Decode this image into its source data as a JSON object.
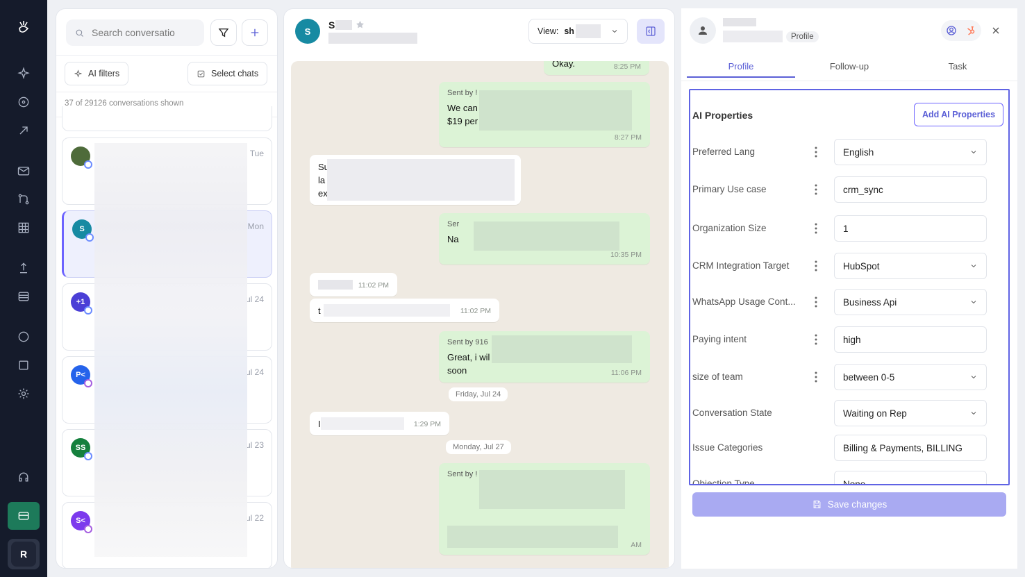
{
  "search": {
    "placeholder": "Search conversatio"
  },
  "filters": {
    "ai_filters": "AI filters",
    "select_chats": "Select chats"
  },
  "count_text": "37 of 29126 conversations shown",
  "conversations": [
    {
      "initials": "",
      "date": "Tue",
      "color": "#4e6b3a"
    },
    {
      "initials": "S",
      "date": "Mon",
      "color": "#178aa2"
    },
    {
      "initials": "+1",
      "date": "ul 24",
      "color": "#4b3fd6"
    },
    {
      "initials": "P<",
      "date": "ul 24",
      "color": "#2563eb"
    },
    {
      "initials": "SS",
      "date": "ul 23",
      "color": "#15803d"
    },
    {
      "initials": "S<",
      "date": "ul 22",
      "color": "#7c3aed"
    }
  ],
  "chat": {
    "avatar": "S",
    "name": "S",
    "view_label": "View:",
    "view_value": "sh",
    "messages": [
      {
        "text": "Okay.",
        "time": "8:25 PM"
      },
      {
        "sent_by": "Sent by !",
        "text": "We can\n$19 per",
        "time": "8:27 PM"
      },
      {
        "text": "Su\nla\nex"
      },
      {
        "sent_by": "Ser",
        "text": "Na",
        "time": "10:35 PM"
      },
      {
        "time": "11:02 PM"
      },
      {
        "text": "t",
        "time": "11:02 PM"
      },
      {
        "sent_by": "Sent by 916",
        "text": "Great, i wil\nsoon",
        "time": "11:06 PM"
      },
      {
        "date": "Friday, Jul 24"
      },
      {
        "text": "I",
        "time": "1:29 PM"
      },
      {
        "date": "Monday, Jul 27"
      },
      {
        "sent_by": "Sent by !",
        "time": "AM"
      }
    ]
  },
  "profile": {
    "badge": "Profile",
    "tabs": [
      "Profile",
      "Follow-up",
      "Task"
    ],
    "section_title": "AI Properties",
    "add_button": "Add AI Properties",
    "properties": [
      {
        "label": "Preferred Lang",
        "value": "English",
        "dropdown": true
      },
      {
        "label": "Primary Use case",
        "value": "crm_sync",
        "dropdown": false
      },
      {
        "label": "Organization Size",
        "value": "1",
        "dropdown": false
      },
      {
        "label": "CRM Integration Target",
        "value": "HubSpot",
        "dropdown": true
      },
      {
        "label": "WhatsApp Usage Cont...",
        "value": "Business Api",
        "dropdown": true
      },
      {
        "label": "Paying intent",
        "value": "high",
        "dropdown": false
      },
      {
        "label": "size of team",
        "value": "between 0-5",
        "dropdown": true
      },
      {
        "label": "Conversation State",
        "value": "Waiting on Rep",
        "dropdown": true
      },
      {
        "label": "Issue Categories",
        "value": "Billing & Payments, BILLING",
        "dropdown": false
      },
      {
        "label": "Objection Type",
        "value": "None",
        "dropdown": false
      }
    ],
    "save_button": "Save changes"
  },
  "rail": {
    "user_initial": "R"
  }
}
